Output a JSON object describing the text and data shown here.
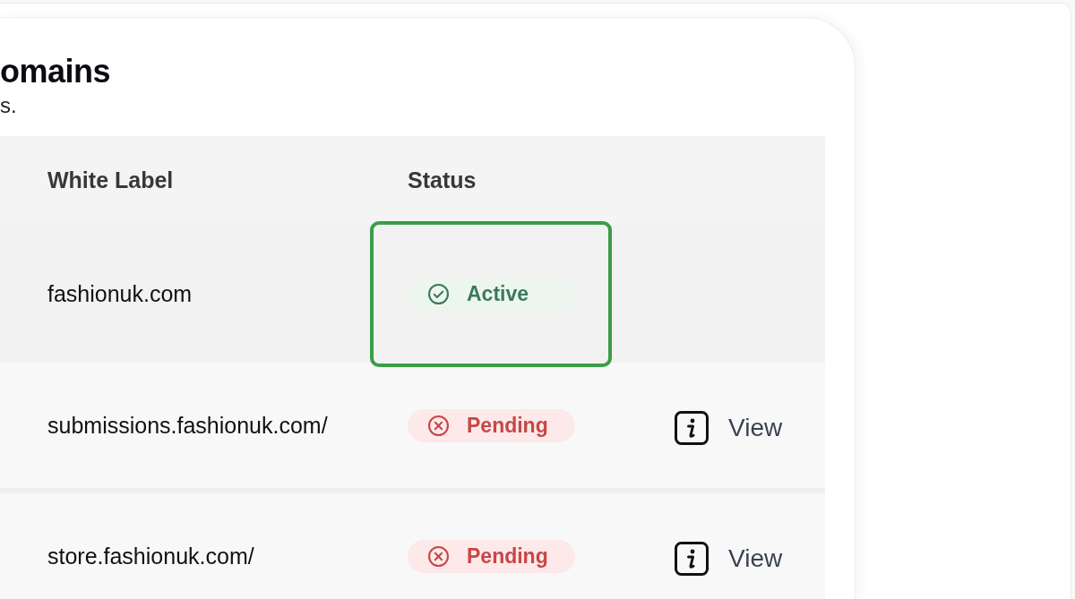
{
  "page": {
    "title": "omains",
    "subtitle": "s."
  },
  "table": {
    "columns": [
      "White Label",
      "Status"
    ],
    "rows": [
      {
        "white_label": "fashionuk.com",
        "status": {
          "label": "Active",
          "kind": "active"
        },
        "highlighted": true
      },
      {
        "white_label": "submissions.fashionuk.com/",
        "status": {
          "label": "Pending",
          "kind": "pending"
        },
        "action": "View",
        "highlighted": false
      },
      {
        "white_label": "store.fashionuk.com/",
        "status": {
          "label": "Pending",
          "kind": "pending"
        },
        "action": "View",
        "highlighted": false
      }
    ]
  }
}
